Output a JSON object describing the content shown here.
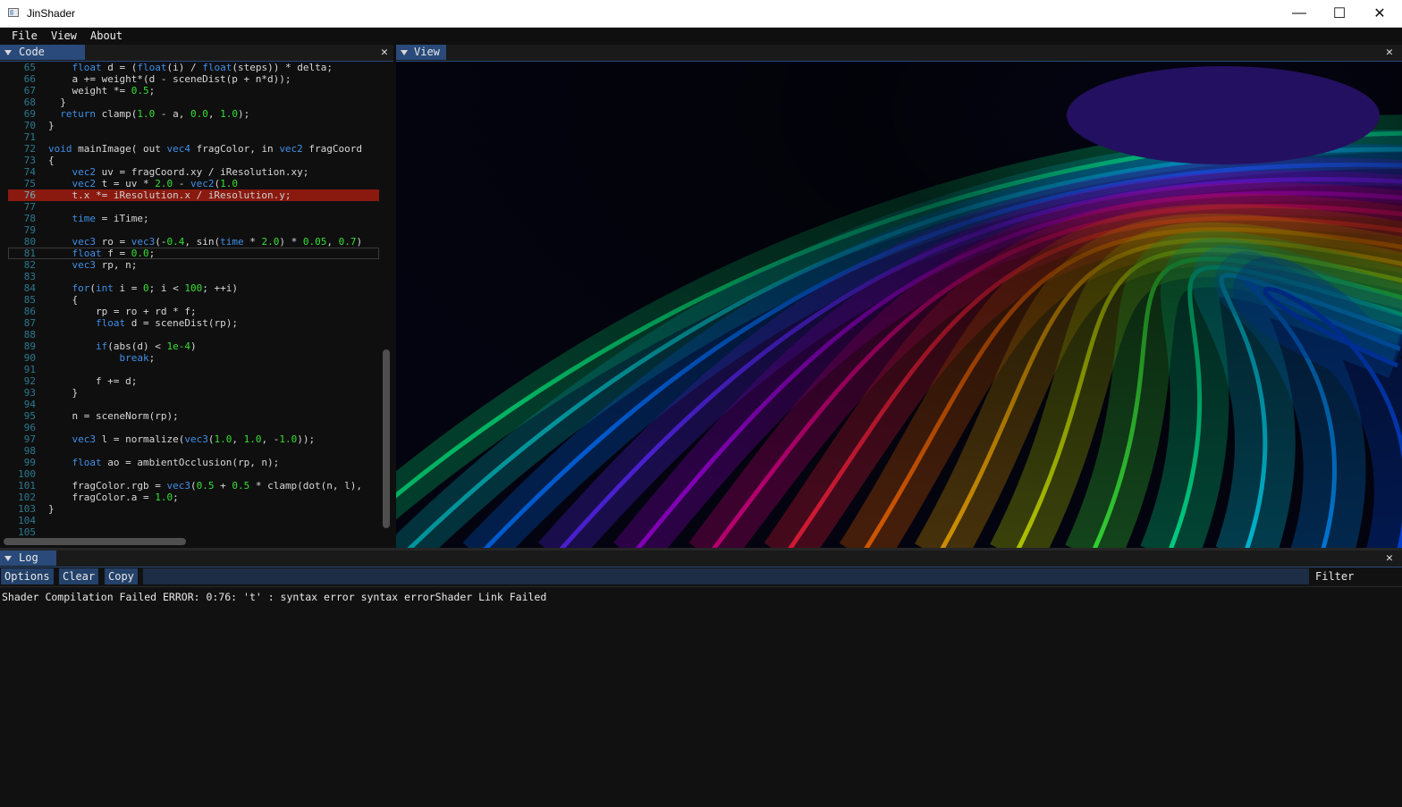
{
  "window": {
    "title": "JinShader",
    "controls": {
      "minimize": "—",
      "maximize": "☐",
      "close": "✕"
    }
  },
  "menu": {
    "items": [
      "File",
      "View",
      "About"
    ]
  },
  "code_panel": {
    "tab_label": "Code",
    "error_line": "76",
    "cursor_line": "81",
    "lines": [
      {
        "n": "65",
        "text": "    float d = (float(i) / float(steps)) * delta;"
      },
      {
        "n": "66",
        "text": "    a += weight*(d - sceneDist(p + n*d));"
      },
      {
        "n": "67",
        "text": "    weight *= 0.5;"
      },
      {
        "n": "68",
        "text": "  }"
      },
      {
        "n": "69",
        "text": "  return clamp(1.0 - a, 0.0, 1.0);"
      },
      {
        "n": "70",
        "text": "}"
      },
      {
        "n": "71",
        "text": ""
      },
      {
        "n": "72",
        "text": "void mainImage( out vec4 fragColor, in vec2 fragCoord"
      },
      {
        "n": "73",
        "text": "{"
      },
      {
        "n": "74",
        "text": "    vec2 uv = fragCoord.xy / iResolution.xy;"
      },
      {
        "n": "75",
        "text": "    vec2 t = uv * 2.0 - vec2(1.0"
      },
      {
        "n": "76",
        "text": "    t.x *= iResolution.x / iResolution.y;"
      },
      {
        "n": "77",
        "text": ""
      },
      {
        "n": "78",
        "text": "    time = iTime;"
      },
      {
        "n": "79",
        "text": ""
      },
      {
        "n": "80",
        "text": "    vec3 ro = vec3(-0.4, sin(time * 2.0) * 0.05, 0.7)"
      },
      {
        "n": "81",
        "text": "    float f = 0.0;"
      },
      {
        "n": "82",
        "text": "    vec3 rp, n;"
      },
      {
        "n": "83",
        "text": ""
      },
      {
        "n": "84",
        "text": "    for(int i = 0; i < 100; ++i)"
      },
      {
        "n": "85",
        "text": "    {"
      },
      {
        "n": "86",
        "text": "        rp = ro + rd * f;"
      },
      {
        "n": "87",
        "text": "        float d = sceneDist(rp);"
      },
      {
        "n": "88",
        "text": ""
      },
      {
        "n": "89",
        "text": "        if(abs(d) < 1e-4)"
      },
      {
        "n": "90",
        "text": "            break;"
      },
      {
        "n": "91",
        "text": ""
      },
      {
        "n": "92",
        "text": "        f += d;"
      },
      {
        "n": "93",
        "text": "    }"
      },
      {
        "n": "94",
        "text": ""
      },
      {
        "n": "95",
        "text": "    n = sceneNorm(rp);"
      },
      {
        "n": "96",
        "text": ""
      },
      {
        "n": "97",
        "text": "    vec3 l = normalize(vec3(1.0, 1.0, -1.0));"
      },
      {
        "n": "98",
        "text": ""
      },
      {
        "n": "99",
        "text": "    float ao = ambientOcclusion(rp, n);"
      },
      {
        "n": "100",
        "text": ""
      },
      {
        "n": "101",
        "text": "    fragColor.rgb = vec3(0.5 + 0.5 * clamp(dot(n, l),"
      },
      {
        "n": "102",
        "text": "    fragColor.a = 1.0;"
      },
      {
        "n": "103",
        "text": "}"
      },
      {
        "n": "104",
        "text": ""
      },
      {
        "n": "105",
        "text": ""
      }
    ]
  },
  "view_panel": {
    "tab_label": "View",
    "stripe_colors": [
      "#00e07a",
      "#00b8c0",
      "#0070ff",
      "#5a28ff",
      "#a000e0",
      "#e0008a",
      "#ff2040",
      "#ff6a00",
      "#ffb000",
      "#d8f000",
      "#40ff40",
      "#00ffa0",
      "#00e0ff",
      "#0090ff",
      "#0050ff"
    ]
  },
  "log_panel": {
    "tab_label": "Log",
    "buttons": {
      "options": "Options",
      "clear": "Clear",
      "copy": "Copy"
    },
    "filter_label": "Filter",
    "filter_value": "",
    "messages": [
      "Shader Compilation Failed ERROR: 0:76: 't' : syntax error syntax errorShader Link Failed"
    ]
  },
  "colors": {
    "accent": "#294a7a",
    "error_line_bg": "#8a1a0f",
    "keyword": "#3f8fe8",
    "number": "#33e033"
  }
}
